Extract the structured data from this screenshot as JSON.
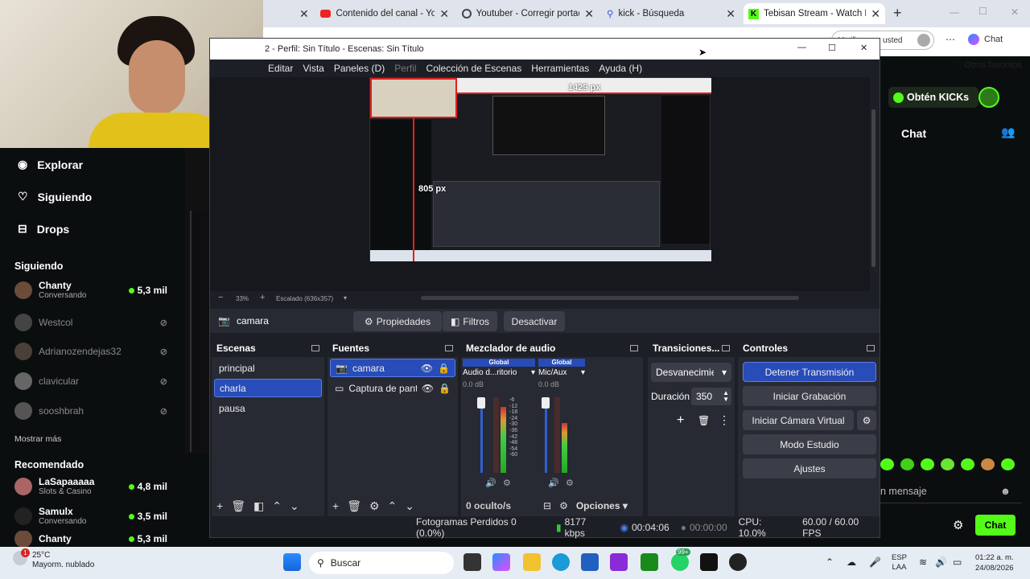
{
  "browser": {
    "tabs": [
      {
        "title": "Contenido del canal - YouTube",
        "icon": "youtube-icon"
      },
      {
        "title": "Youtuber - Corregir portada fo",
        "icon": "chatgpt-icon"
      },
      {
        "title": "kick - Búsqueda",
        "icon": "search-icon"
      },
      {
        "title": "Tebisan Stream - Watch Live o",
        "icon": "kick-icon"
      }
    ],
    "profile_label": "Verifique es usted",
    "chat_label": "Chat",
    "favorites_label": "Otros favoritos"
  },
  "kick": {
    "nav": [
      {
        "label": "Explorar",
        "icon": "compass-icon"
      },
      {
        "label": "Siguiendo",
        "icon": "heart-icon"
      },
      {
        "label": "Drops",
        "icon": "drops-icon"
      }
    ],
    "following_title": "Siguiendo",
    "following": [
      {
        "name": "Chanty",
        "sub": "Conversando",
        "viewers": "5,3 mil",
        "live": true
      },
      {
        "name": "Westcol",
        "sub": "",
        "viewers": "",
        "live": false
      },
      {
        "name": "Adrianozendejas32",
        "sub": "",
        "viewers": "",
        "live": false
      },
      {
        "name": "clavicular",
        "sub": "",
        "viewers": "",
        "live": false
      },
      {
        "name": "sooshbrah",
        "sub": "",
        "viewers": "",
        "live": false
      }
    ],
    "show_more": "Mostrar más",
    "recommended_title": "Recomendado",
    "recommended": [
      {
        "name": "LaSapaaaaa",
        "sub": "Slots & Casino",
        "viewers": "4,8 mil"
      },
      {
        "name": "Samulx",
        "sub": "Conversando",
        "viewers": "3,5 mil"
      },
      {
        "name": "Chanty",
        "sub": "",
        "viewers": "5,3 mil"
      }
    ],
    "get_kicks": "Obtén KICKs",
    "chat_title": "Chat",
    "message_placeholder": "n mensaje",
    "chat_button": "Chat",
    "accent": "#53fc18"
  },
  "obs": {
    "title": "2 - Perfil: Sin Título - Escenas: Sin Título",
    "menu": [
      "Editar",
      "Vista",
      "Paneles (D)",
      "Perfil",
      "Colección de Escenas",
      "Herramientas",
      "Ayuda (H)"
    ],
    "preview_width_label": "1429 px",
    "preview_height_label": "805 px",
    "zoom_label": "33%",
    "scale_label": "Escalado (636x357)",
    "source_name": "camara",
    "properties_label": "Propiedades",
    "filters_label": "Filtros",
    "deactivate_label": "Desactivar",
    "scenes_title": "Escenas",
    "scenes": [
      "principal",
      "charla",
      "pausa"
    ],
    "selected_scene": "charla",
    "sources_title": "Fuentes",
    "sources": [
      {
        "name": "camara",
        "icon": "camera-icon"
      },
      {
        "name": "Captura de panta",
        "icon": "monitor-icon"
      }
    ],
    "mixer_title": "Mezclador de audio",
    "mixer": [
      {
        "label": "Global",
        "device": "Audio d...ritorio",
        "db": "0.0 dB"
      },
      {
        "label": "Global",
        "device": "Mic/Aux",
        "db": "0.0 dB"
      }
    ],
    "meter_ticks": [
      "-6",
      "-12",
      "-18",
      "-24",
      "-30",
      "-36",
      "-42",
      "-48",
      "-54",
      "-60"
    ],
    "mixer_hidden": "0 oculto/s",
    "mixer_options": "Opciones",
    "transitions_title": "Transiciones...",
    "transition_value": "Desvanecimie",
    "duration_label": "Duración",
    "duration_value": "350",
    "controls_title": "Controles",
    "controls": [
      "Detener Transmisión",
      "Iniciar Grabación",
      "Iniciar Cámara Virtual",
      "Modo Estudio",
      "Ajustes"
    ],
    "status": {
      "dropped": "Fotogramas Perdidos 0 (0.0%)",
      "bitrate": "8177 kbps",
      "stream_time": "00:04:06",
      "rec_time": "00:00:00",
      "cpu": "CPU: 10.0%",
      "fps": "60.00 / 60.00 FPS"
    }
  },
  "taskbar": {
    "weather_temp": "25°C",
    "weather_desc": "Mayorm. nublado",
    "weather_badge": "1",
    "search_label": "Buscar",
    "notif_badge": "99+",
    "lang1": "ESP",
    "lang2": "LAA",
    "time": "01:22 a. m.",
    "date": "24/08/2026"
  }
}
